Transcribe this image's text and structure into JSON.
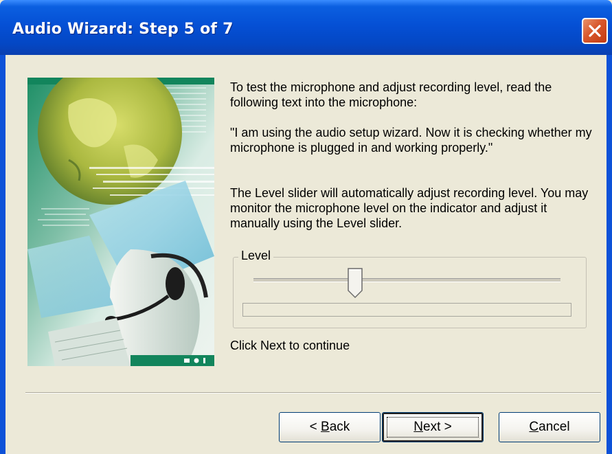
{
  "window": {
    "title": "Audio Wizard: Step 5 of 7",
    "close_icon": "close-icon"
  },
  "instructions": {
    "paragraph1": "To test the microphone and adjust recording level, read the following text into the microphone:",
    "quote": "\"I am using the audio setup wizard. Now it is checking whether my microphone is plugged in and working properly.\"",
    "paragraph3": "The Level slider will automatically adjust recording level. You may monitor the microphone level on the indicator and adjust it manually using the Level slider."
  },
  "level_group": {
    "label": "Level",
    "slider_value_fraction": 0.33,
    "meter_fill_fraction": 0.0
  },
  "continue_text": "Click Next to continue",
  "buttons": {
    "back": {
      "prefix": "< ",
      "mnemonic": "B",
      "rest": "ack"
    },
    "next": {
      "mnemonic": "N",
      "rest": "ext >"
    },
    "cancel": {
      "mnemonic": "C",
      "rest": "ancel"
    }
  },
  "colors": {
    "title_bar": "#0550d5",
    "dialog_background": "#ece9d8",
    "close_button": "#d8572c",
    "picture_accent": "#12855c"
  }
}
